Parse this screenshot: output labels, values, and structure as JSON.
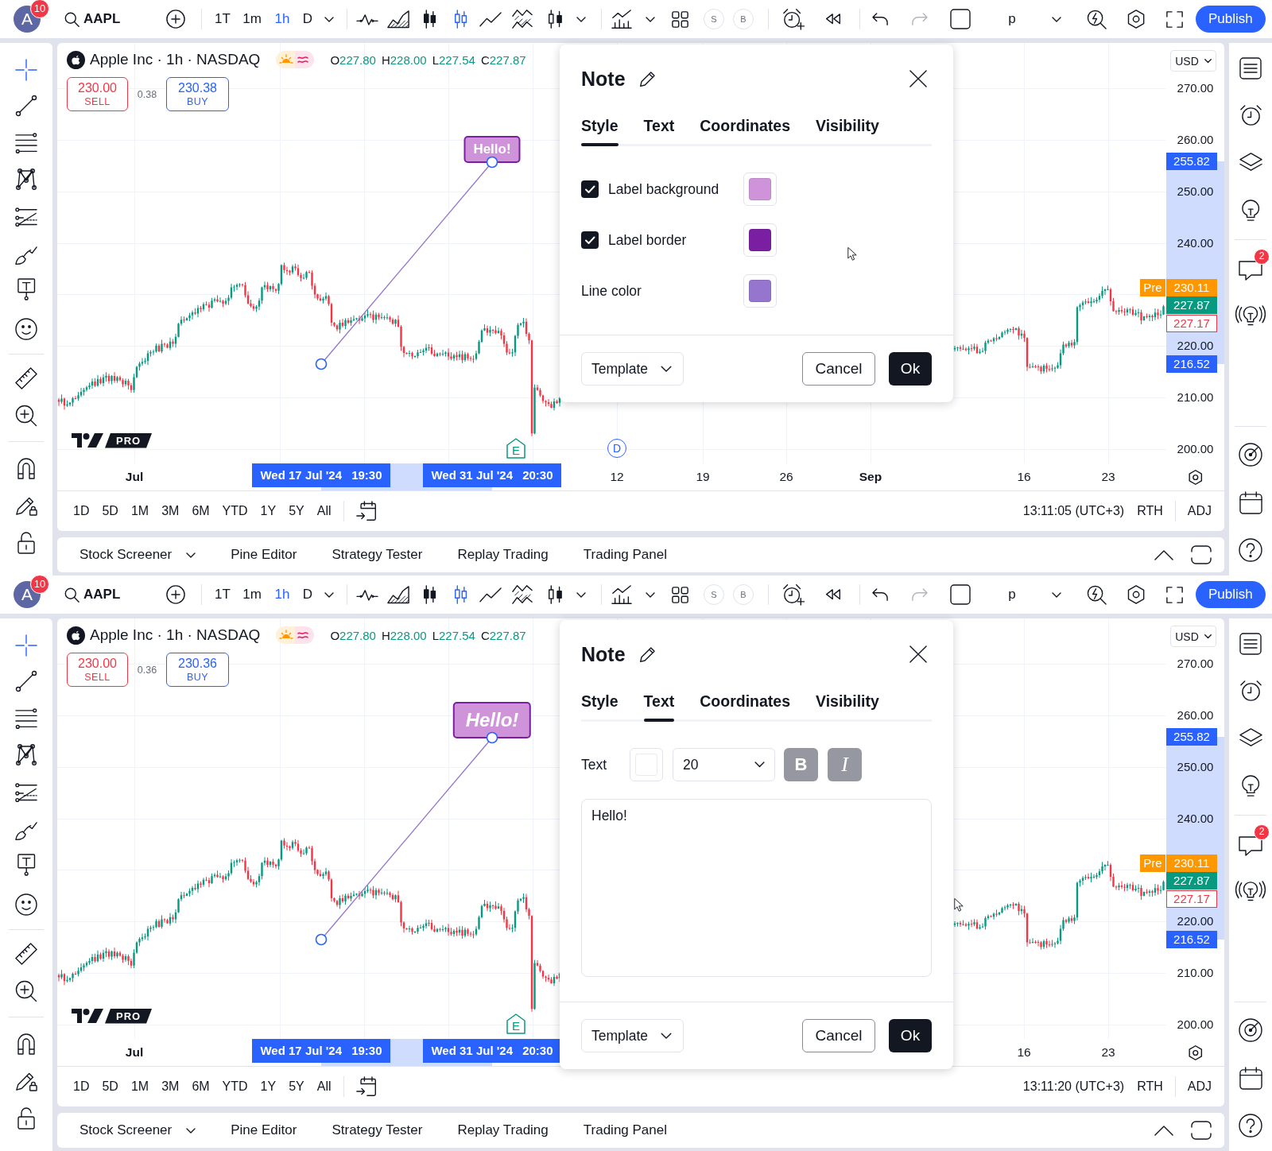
{
  "panels": [
    {
      "top_bar": {
        "avatar": "A",
        "notifications": "10",
        "symbol": "AAPL",
        "intervals": [
          {
            "label": "1T",
            "selected": false
          },
          {
            "label": "1m",
            "selected": false
          },
          {
            "label": "1h",
            "selected": true
          },
          {
            "label": "D",
            "selected": false
          }
        ],
        "chart_styles": [
          {
            "selected": false
          },
          {
            "selected": false
          },
          {
            "selected": false
          },
          {
            "selected": true
          },
          {
            "selected": false
          },
          {
            "selected": false
          },
          {
            "selected": false
          }
        ],
        "toggles": [
          "S",
          "B"
        ],
        "undo": {
          "disabled": false
        },
        "redo": {
          "disabled": true
        },
        "layout": "p",
        "publish": "Publish"
      },
      "drawing_tools": [
        {
          "selected": true
        },
        {
          "selected": false
        },
        {
          "selected": false
        },
        {
          "selected": false
        },
        {
          "selected": false
        },
        {
          "selected": false
        },
        {
          "selected": false
        },
        {
          "selected": false
        },
        {
          "selected": false
        },
        {
          "selected": false
        },
        {
          "selected": false
        },
        {
          "selected": false
        },
        {
          "selected": false
        }
      ],
      "chart": {
        "symbol_title": "Apple Inc · 1h · NASDAQ",
        "ohlc": [
          {
            "label": "O",
            "value": "227.80"
          },
          {
            "label": "H",
            "value": "228.00"
          },
          {
            "label": "L",
            "value": "227.54"
          },
          {
            "label": "C",
            "value": "227.87"
          }
        ],
        "sell": {
          "price": "230.00",
          "label": "SELL"
        },
        "spread": "0.38",
        "buy": {
          "price": "230.38",
          "label": "BUY"
        },
        "note": {
          "text": "Hello!",
          "bold": true,
          "italic": false
        },
        "events": [
          {
            "kind": "earnings",
            "letter": "E"
          },
          {
            "kind": "dividend",
            "letter": "D"
          }
        ],
        "logo_badge": "PRO",
        "currency": "USD",
        "price_ticks": [
          "270.00",
          "260.00",
          "250.00",
          "240.00",
          "220.00",
          "210.00",
          "200.00"
        ],
        "price_labels": [
          {
            "kind": "range",
            "value": "255.82"
          },
          {
            "kind": "premarket",
            "tag": "Pre",
            "value": "230.11"
          },
          {
            "kind": "last",
            "value": "227.87"
          },
          {
            "kind": "previous",
            "value": "227.17"
          },
          {
            "kind": "range",
            "value": "216.52"
          }
        ],
        "range_labels": [
          {
            "date": "Wed 17 Jul '24",
            "time": "19:30"
          },
          {
            "date": "Wed 31 Jul '24",
            "time": "20:30"
          }
        ],
        "time_labels": {
          "left": [
            {
              "text": "Jul",
              "kind": "month"
            }
          ],
          "right": [
            {
              "text": "12",
              "kind": "day"
            },
            {
              "text": "19",
              "kind": "day"
            },
            {
              "text": "26",
              "kind": "day"
            },
            {
              "text": "Sep",
              "kind": "month"
            },
            {
              "text": "16",
              "kind": "day"
            },
            {
              "text": "23",
              "kind": "day"
            }
          ]
        }
      },
      "range_bar": {
        "ranges": [
          "1D",
          "5D",
          "1M",
          "3M",
          "6M",
          "YTD",
          "1Y",
          "5Y",
          "All"
        ],
        "clock": "13:11:05 (UTC+3)",
        "session": "RTH",
        "adjustment": "ADJ"
      },
      "bottom_tabs": [
        {
          "label": "Stock Screener",
          "kind": "menu"
        },
        {
          "label": "Pine Editor",
          "kind": "tab"
        },
        {
          "label": "Strategy Tester",
          "kind": "tab"
        },
        {
          "label": "Replay Trading",
          "kind": "tab"
        },
        {
          "label": "Trading Panel",
          "kind": "tab"
        }
      ],
      "side_toolbar": {
        "chat_badge": "2"
      },
      "dialog": {
        "title": "Note",
        "tabs": [
          {
            "label": "Style",
            "selected": true
          },
          {
            "label": "Text",
            "selected": false
          },
          {
            "label": "Coordinates",
            "selected": false
          },
          {
            "label": "Visibility",
            "selected": false
          }
        ],
        "body": {
          "kind": "style",
          "rows": [
            {
              "kind": "checkbox",
              "label": "Label background",
              "checked": true,
              "color": "#ce93d8"
            },
            {
              "kind": "checkbox",
              "label": "Label border",
              "checked": true,
              "color": "#7b1fa2"
            },
            {
              "kind": "color",
              "label": "Line color",
              "color": "#9575cd"
            }
          ]
        },
        "template": "Template",
        "cancel": "Cancel",
        "ok": "Ok"
      }
    },
    {
      "top_bar": {
        "avatar": "A",
        "notifications": "10",
        "symbol": "AAPL",
        "intervals": [
          {
            "label": "1T",
            "selected": false
          },
          {
            "label": "1m",
            "selected": false
          },
          {
            "label": "1h",
            "selected": true
          },
          {
            "label": "D",
            "selected": false
          }
        ],
        "chart_styles": [
          {
            "selected": false
          },
          {
            "selected": false
          },
          {
            "selected": false
          },
          {
            "selected": true
          },
          {
            "selected": false
          },
          {
            "selected": false
          },
          {
            "selected": false
          }
        ],
        "toggles": [
          "S",
          "B"
        ],
        "undo": {
          "disabled": false
        },
        "redo": {
          "disabled": true
        },
        "layout": "p",
        "publish": "Publish"
      },
      "drawing_tools": [
        {
          "selected": true
        },
        {
          "selected": false
        },
        {
          "selected": false
        },
        {
          "selected": false
        },
        {
          "selected": false
        },
        {
          "selected": false
        },
        {
          "selected": false
        },
        {
          "selected": false
        },
        {
          "selected": false
        },
        {
          "selected": false
        },
        {
          "selected": false
        },
        {
          "selected": false
        },
        {
          "selected": false
        }
      ],
      "chart": {
        "symbol_title": "Apple Inc · 1h · NASDAQ",
        "ohlc": [
          {
            "label": "O",
            "value": "227.80"
          },
          {
            "label": "H",
            "value": "228.00"
          },
          {
            "label": "L",
            "value": "227.54"
          },
          {
            "label": "C",
            "value": "227.87"
          }
        ],
        "sell": {
          "price": "230.00",
          "label": "SELL"
        },
        "spread": "0.36",
        "buy": {
          "price": "230.36",
          "label": "BUY"
        },
        "note": {
          "text": "Hello!",
          "bold": true,
          "italic": true
        },
        "events": [
          {
            "kind": "earnings",
            "letter": "E"
          }
        ],
        "logo_badge": "PRO",
        "currency": "USD",
        "price_ticks": [
          "270.00",
          "260.00",
          "250.00",
          "240.00",
          "220.00",
          "210.00",
          "200.00"
        ],
        "price_labels": [
          {
            "kind": "range",
            "value": "255.82"
          },
          {
            "kind": "premarket",
            "tag": "Pre",
            "value": "230.11"
          },
          {
            "kind": "last",
            "value": "227.87"
          },
          {
            "kind": "previous",
            "value": "227.17"
          },
          {
            "kind": "range",
            "value": "216.52"
          }
        ],
        "range_labels": [
          {
            "date": "Wed 17 Jul '24",
            "time": "19:30"
          },
          {
            "date": "Wed 31 Jul '24",
            "time": "20:30"
          }
        ],
        "time_labels": {
          "left": [
            {
              "text": "Jul",
              "kind": "month"
            }
          ],
          "right": [
            {
              "text": "16",
              "kind": "day"
            },
            {
              "text": "23",
              "kind": "day"
            }
          ]
        }
      },
      "range_bar": {
        "ranges": [
          "1D",
          "5D",
          "1M",
          "3M",
          "6M",
          "YTD",
          "1Y",
          "5Y",
          "All"
        ],
        "clock": "13:11:20 (UTC+3)",
        "session": "RTH",
        "adjustment": "ADJ"
      },
      "bottom_tabs": [
        {
          "label": "Stock Screener",
          "kind": "menu"
        },
        {
          "label": "Pine Editor",
          "kind": "tab"
        },
        {
          "label": "Strategy Tester",
          "kind": "tab"
        },
        {
          "label": "Replay Trading",
          "kind": "tab"
        },
        {
          "label": "Trading Panel",
          "kind": "tab"
        }
      ],
      "side_toolbar": {
        "chat_badge": "2"
      },
      "dialog": {
        "title": "Note",
        "tabs": [
          {
            "label": "Style",
            "selected": false
          },
          {
            "label": "Text",
            "selected": true
          },
          {
            "label": "Coordinates",
            "selected": false
          },
          {
            "label": "Visibility",
            "selected": false
          }
        ],
        "body": {
          "kind": "text",
          "label": "Text",
          "color": "#ffffff",
          "font_size": "20",
          "bold": {
            "label": "B",
            "on": true
          },
          "italic": {
            "label": "I",
            "on": true
          },
          "value": "Hello!"
        },
        "template": "Template",
        "cancel": "Cancel",
        "ok": "Ok"
      }
    }
  ]
}
